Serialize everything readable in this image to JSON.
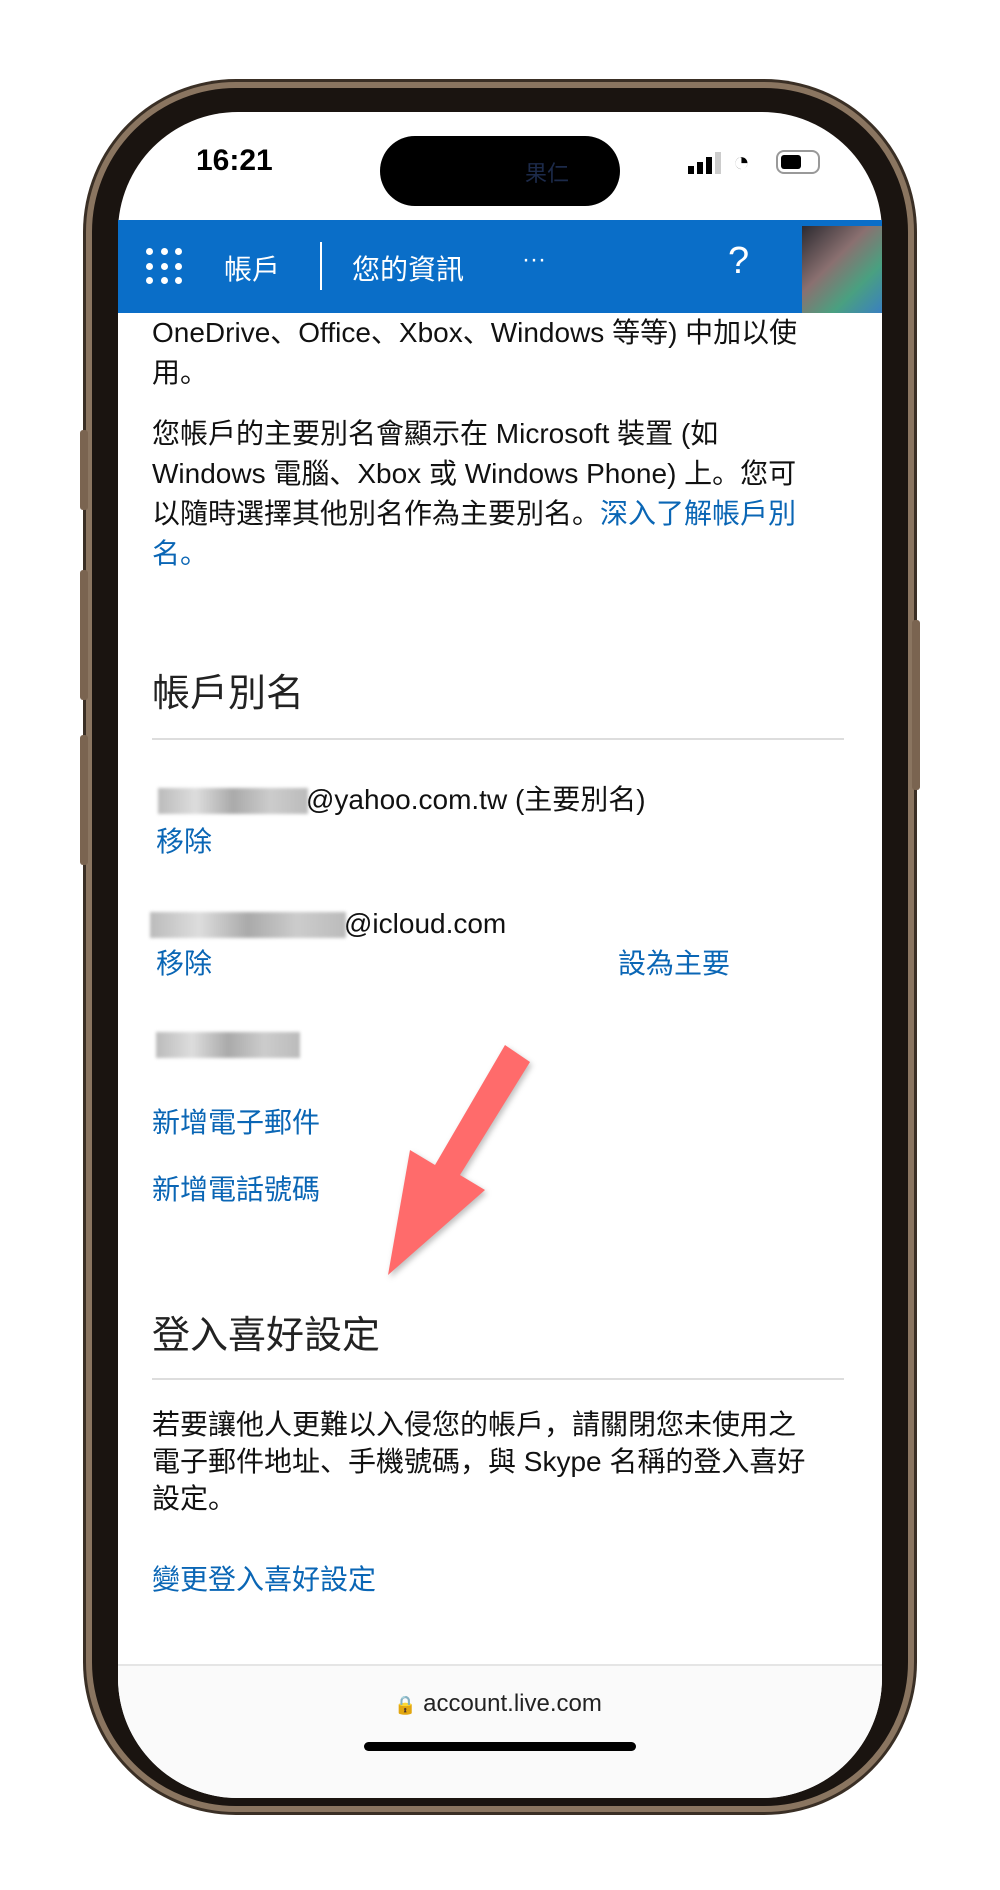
{
  "status_bar": {
    "time": "16:21",
    "island_text": "果仁"
  },
  "nav": {
    "apps_icon": "grid-icon",
    "account": "帳戶",
    "your_info": "您的資訊",
    "more": "···",
    "help": "?"
  },
  "content": {
    "intro_tail_1": "OneDrive、Office、Xbox、Windows 等等) 中加以使",
    "intro_tail_2": "用。",
    "primary_alias_text_1": "您帳戶的主要別名會顯示在 Microsoft 裝置 (如",
    "primary_alias_text_2": "Windows 電腦、Xbox 或 Windows Phone) 上。您可",
    "primary_alias_text_3": "以隨時選擇其他別名作為主要別名。",
    "learn_more_1": "深入了解帳戶別",
    "learn_more_2": "名。",
    "aliases_heading": "帳戶別名",
    "aliases": [
      {
        "email": "@yahoo.com.tw (主要別名)",
        "remove": "移除"
      },
      {
        "email": "@icloud.com",
        "remove": "移除",
        "make_primary": "設為主要"
      }
    ],
    "add_email": "新增電子郵件",
    "add_phone": "新增電話號碼",
    "signin_heading": "登入喜好設定",
    "signin_text_1": "若要讓他人更難以入侵您的帳戶，請關閉您未使用之",
    "signin_text_2": "電子郵件地址、手機號碼，與 Skype 名稱的登入喜好",
    "signin_text_3": "設定。",
    "change_signin": "變更登入喜好設定"
  },
  "browser": {
    "url": "account.live.com"
  },
  "colors": {
    "nav": "#0a6ec8",
    "link": "#0a66b5",
    "arrow": "#ff6b6b"
  }
}
